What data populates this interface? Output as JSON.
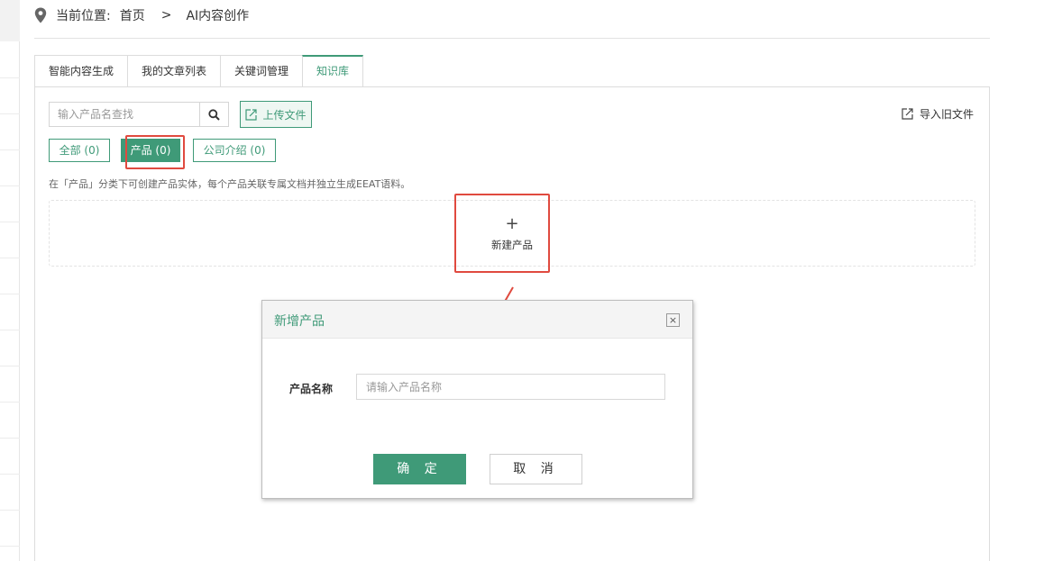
{
  "breadcrumb": {
    "prefix": "当前位置:",
    "home": "首页",
    "separator": ">",
    "current": "AI内容创作"
  },
  "tabs": [
    {
      "label": "智能内容生成"
    },
    {
      "label": "我的文章列表"
    },
    {
      "label": "关键词管理"
    },
    {
      "label": "知识库",
      "active": true
    }
  ],
  "toolbar": {
    "search_placeholder": "输入产品名查找",
    "upload_label": "上传文件",
    "import_label": "导入旧文件"
  },
  "filters": [
    {
      "label": "全部 (0)"
    },
    {
      "label": "产品 (0)",
      "active": true
    },
    {
      "label": "公司介绍 (0)"
    }
  ],
  "hint": "在「产品」分类下可创建产品实体，每个产品关联专属文档并独立生成EEAT语料。",
  "new_product": {
    "icon": "+",
    "label": "新建产品"
  },
  "dialog": {
    "title": "新增产品",
    "close_icon": "×",
    "field_label": "产品名称",
    "field_placeholder": "请输入产品名称",
    "field_value": "",
    "confirm_label": "确 定",
    "cancel_label": "取 消"
  },
  "colors": {
    "accent": "#3f9a78",
    "annotation": "#e04a3f"
  }
}
